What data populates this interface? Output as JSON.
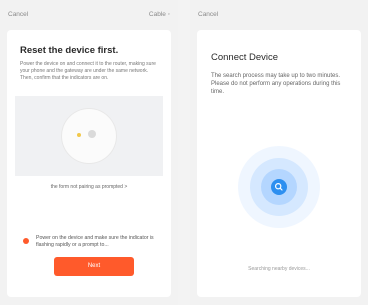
{
  "left": {
    "cancel": "Cancel",
    "top_right": "Cable ◦",
    "title": "Reset the device first.",
    "description": "Power the device on and connect it to the router, making sure your phone and the gateway are under the same network. Then, confirm that the indicators are on.",
    "help_link": "the form not pairing as prompted >",
    "confirm_text": "Power on the device and make sure the indicator is flashing rapidly or a prompt to...",
    "next_label": "Next"
  },
  "right": {
    "cancel": "Cancel",
    "title": "Connect Device",
    "description": "The search process may take up to two minutes. Please do not perform any operations during this time.",
    "status": "Searching nearby devices..."
  },
  "colors": {
    "accent": "#ff5a2b",
    "scan": "#2d8ff0"
  }
}
